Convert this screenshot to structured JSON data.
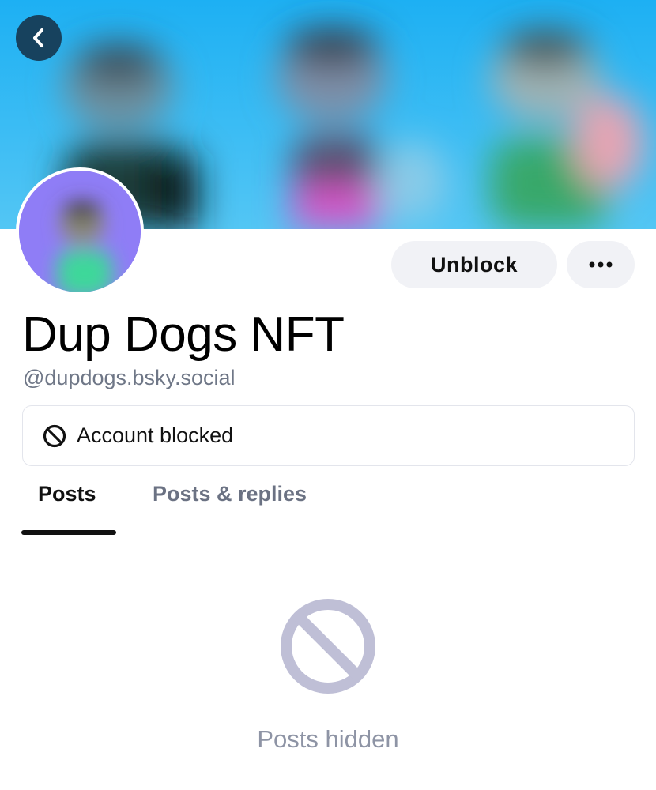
{
  "profile": {
    "display_name": "Dup Dogs NFT",
    "handle": "@dupdogs.bsky.social"
  },
  "actions": {
    "unblock_label": "Unblock",
    "more_icon": "ellipsis-icon"
  },
  "navigation": {
    "back_icon": "chevron-left-icon"
  },
  "notice": {
    "label": "Account blocked",
    "icon": "block-icon"
  },
  "tabs": [
    {
      "label": "Posts",
      "selected": true
    },
    {
      "label": "Posts & replies",
      "selected": false
    }
  ],
  "empty_state": {
    "label": "Posts hidden",
    "icon": "block-icon"
  },
  "colors": {
    "banner": "#27b3f2",
    "back_button": "#17425e",
    "button_bg": "#f1f2f6",
    "handle_text": "#6f7787",
    "empty_icon": "#bfbfd6",
    "tab_inactive": "#6b7283"
  }
}
